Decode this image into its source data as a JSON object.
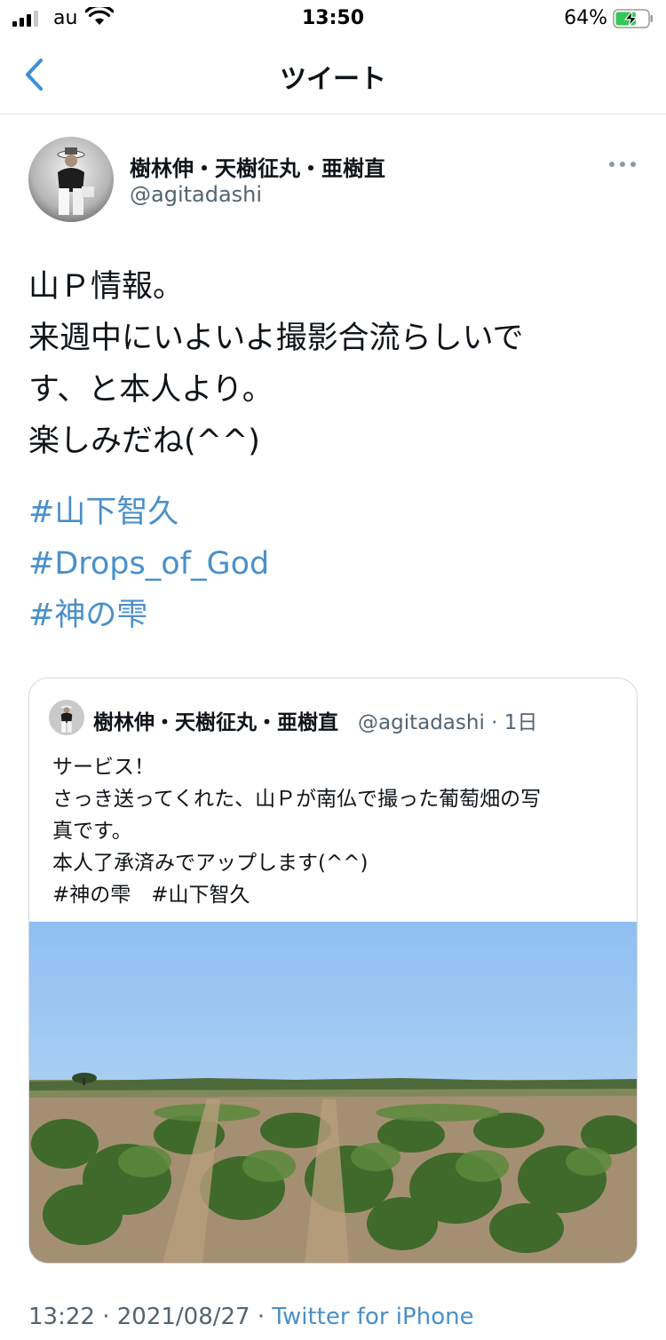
{
  "status_bar": {
    "carrier": "au",
    "time": "13:50",
    "battery_percent": "64%",
    "battery_level": 0.64,
    "signal_bars": 3,
    "icons": [
      "signal-icon",
      "wifi-icon",
      "battery-charging-icon"
    ]
  },
  "nav": {
    "title": "ツイート",
    "back_icon": "chevron-left-icon"
  },
  "tweet": {
    "author_name": "樹林伸・天樹征丸・亜樹直",
    "author_handle": "@agitadashi",
    "text_lines": [
      "山Ｐ情報。",
      "来週中にいよいよ撮影合流らしいで",
      "す、と本人より。",
      "楽しみだね(^^)"
    ],
    "hashtags": [
      "#山下智久",
      "#Drops_of_God",
      "#神の雫"
    ],
    "more_icon": "more-horizontal-icon"
  },
  "quoted_tweet": {
    "author_name": "樹林伸・天樹征丸・亜樹直",
    "handle": "@agitadashi",
    "time_ago": "1日",
    "text_lines": [
      "サービス！",
      "さっき送ってくれた、山Ｐが南仏で撮った葡萄畑の写",
      "真です。",
      "本人了承済みでアップします(^^)",
      "#神の雫　#山下智久"
    ]
  },
  "footer": {
    "time": "13:22",
    "date": "2021/08/27",
    "source": "Twitter for iPhone"
  },
  "colors": {
    "link": "#4a90c9",
    "text": "#0f1419",
    "secondary": "#536471",
    "back": "#3b8fd9"
  }
}
